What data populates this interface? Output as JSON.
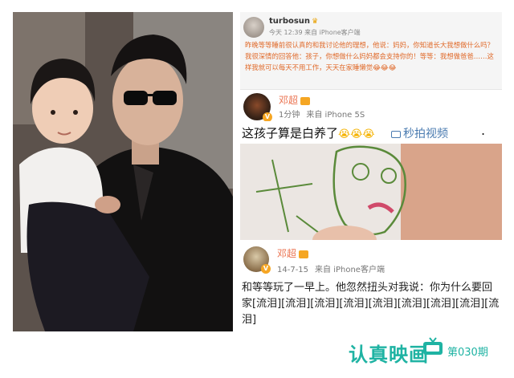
{
  "post_turbosun": {
    "username": "turbosun",
    "meta": "今天 12:39 来自 iPhone客户端",
    "text": "昨晚等等睡前很认真的和我讨论他的理想，他说：妈妈，你知道长大我想做什么吗？我很深情的回答他：孩子，你想做什么妈妈都会支持你的！等等：我想做爸爸……这样我就可以每天不用工作，天天在家睡懒觉😂😂😂"
  },
  "post_dengchao_1": {
    "username": "邓超",
    "time": "1分钟",
    "device": "来自 iPhone 5S",
    "text": "这孩子算是白养了",
    "emoji": "😭😭😭",
    "video_link": "秒拍视频",
    "trailing": "."
  },
  "post_dengchao_2": {
    "username": "邓超",
    "time": "14-7-15",
    "device": "来自 iPhone客户端",
    "text": "和等等玩了一早上。他忽然扭头对我说：你为什么要回家[流泪][流泪][流泪][流泪][流泪][流泪][流泪][流泪][流泪]"
  },
  "watermark": {
    "brand": "认真映画",
    "issue": "第030期",
    "color": "#1fb3a3"
  },
  "colors": {
    "name": "#eb7350",
    "link": "#4a7bb0",
    "orange_text": "#e06a2a"
  }
}
